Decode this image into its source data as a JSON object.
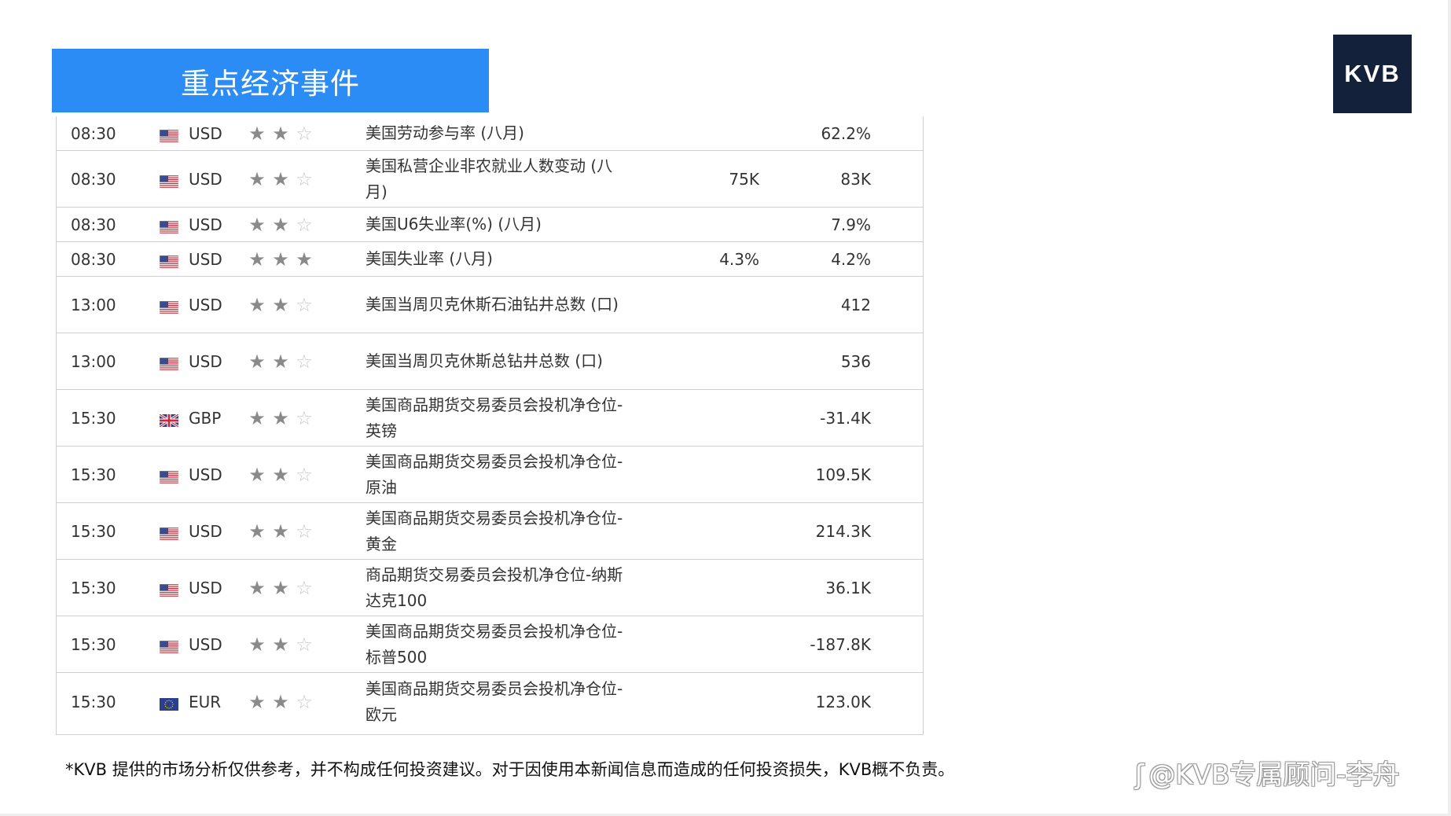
{
  "header": {
    "title": "重点经济事件",
    "logo_text": "KVB"
  },
  "rows": [
    {
      "time": "08:30",
      "flag": "US",
      "currency": "USD",
      "stars": 2,
      "event": "美国劳动参与率 (八月)",
      "forecast": "",
      "actual": "62.2%"
    },
    {
      "time": "08:30",
      "flag": "US",
      "currency": "USD",
      "stars": 2,
      "event": "美国私营企业非农就业人数变动 (八月)",
      "forecast": "75K",
      "actual": "83K"
    },
    {
      "time": "08:30",
      "flag": "US",
      "currency": "USD",
      "stars": 2,
      "event": "美国U6失业率(%) (八月)",
      "forecast": "",
      "actual": "7.9%"
    },
    {
      "time": "08:30",
      "flag": "US",
      "currency": "USD",
      "stars": 3,
      "event": "美国失业率 (八月)",
      "forecast": "4.3%",
      "actual": "4.2%"
    },
    {
      "time": "13:00",
      "flag": "US",
      "currency": "USD",
      "stars": 2,
      "event": "美国当周贝克休斯石油钻井总数 (口)",
      "forecast": "",
      "actual": "412"
    },
    {
      "time": "13:00",
      "flag": "US",
      "currency": "USD",
      "stars": 2,
      "event": "美国当周贝克休斯总钻井总数 (口)",
      "forecast": "",
      "actual": "536"
    },
    {
      "time": "15:30",
      "flag": "GB",
      "currency": "GBP",
      "stars": 2,
      "event": "美国商品期货交易委员会投机净仓位-英镑",
      "forecast": "",
      "actual": "-31.4K"
    },
    {
      "time": "15:30",
      "flag": "US",
      "currency": "USD",
      "stars": 2,
      "event": "美国商品期货交易委员会投机净仓位-原油",
      "forecast": "",
      "actual": "109.5K"
    },
    {
      "time": "15:30",
      "flag": "US",
      "currency": "USD",
      "stars": 2,
      "event": "美国商品期货交易委员会投机净仓位-黄金",
      "forecast": "",
      "actual": "214.3K"
    },
    {
      "time": "15:30",
      "flag": "US",
      "currency": "USD",
      "stars": 2,
      "event": "商品期货交易委员会投机净仓位-纳斯达克100",
      "forecast": "",
      "actual": "36.1K"
    },
    {
      "time": "15:30",
      "flag": "US",
      "currency": "USD",
      "stars": 2,
      "event": "美国商品期货交易委员会投机净仓位-标普500",
      "forecast": "",
      "actual": "-187.8K"
    },
    {
      "time": "15:30",
      "flag": "EU",
      "currency": "EUR",
      "stars": 2,
      "event": "美国商品期货交易委员会投机净仓位-欧元",
      "forecast": "",
      "actual": "123.0K"
    }
  ],
  "disclaimer": "*KVB 提供的市场分析仅供参考，并不构成任何投资建议。对于因使用本新闻信息而造成的任何投资损失，KVB概不负责。",
  "watermark": "@KVB专属顾问-李舟",
  "colors": {
    "title_bg": "#2b8cf5",
    "logo_bg": "#13213a",
    "star_on": "#8a8a8a",
    "star_off": "#c8c8c8"
  }
}
